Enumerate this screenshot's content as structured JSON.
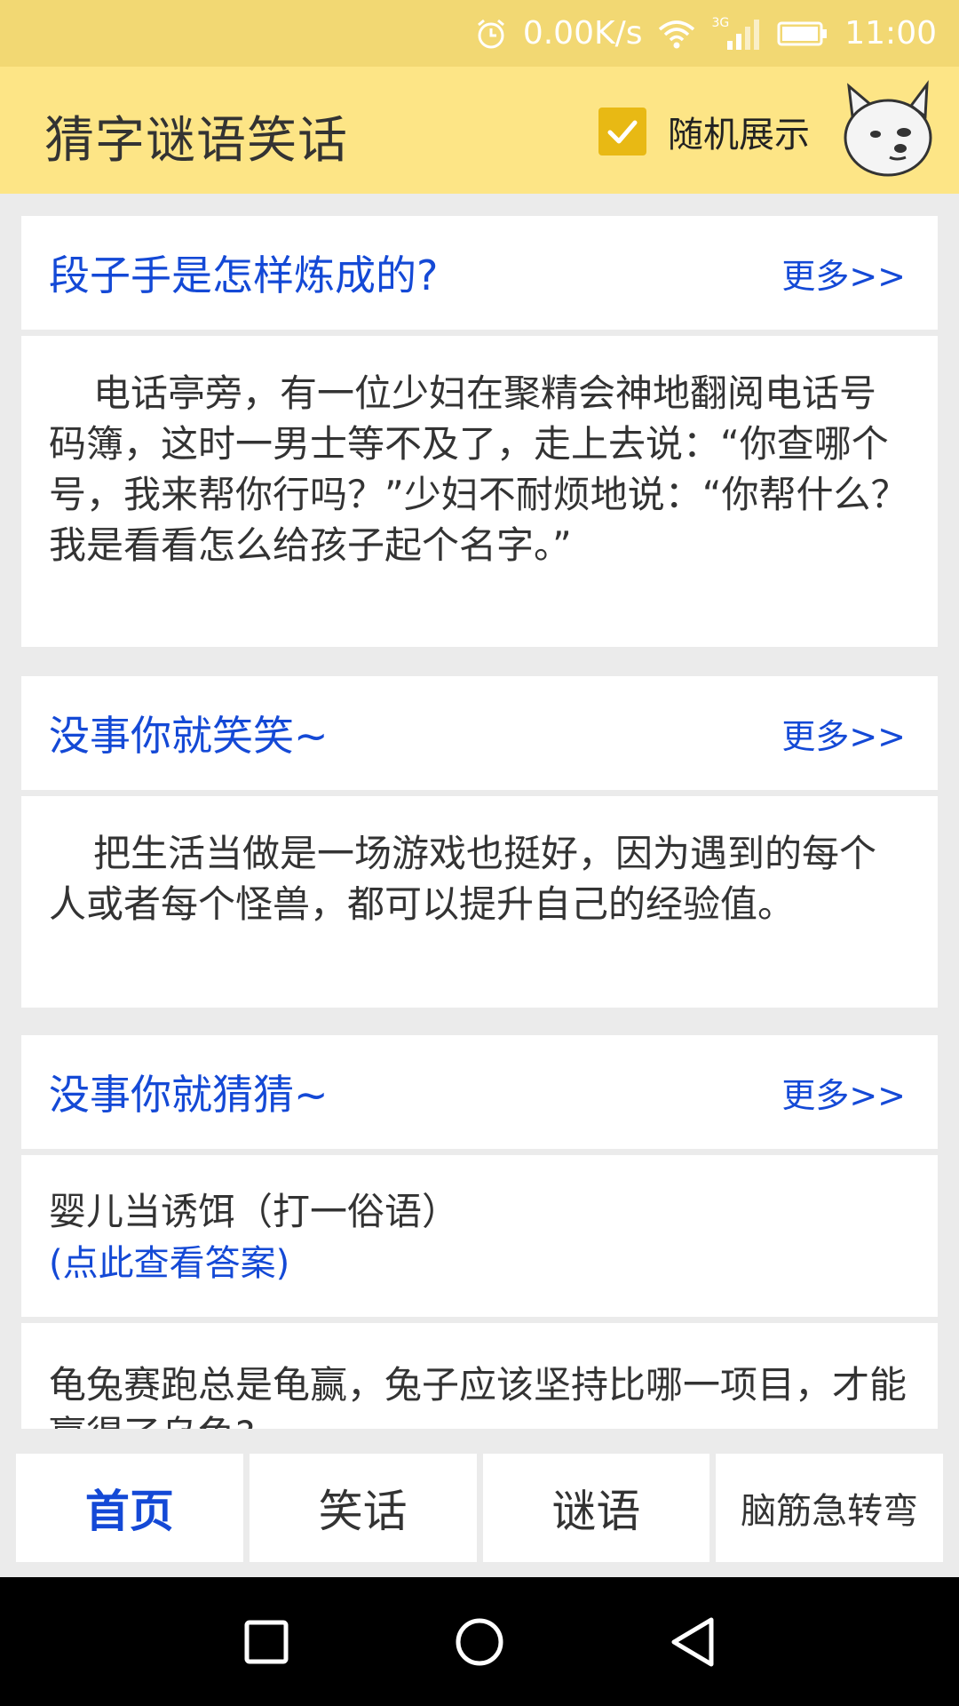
{
  "status_bar": {
    "speed": "0.00K/s",
    "network": "3G",
    "time": "11:00"
  },
  "app_bar": {
    "title": "猜字谜语笑话",
    "random_label": "随机展示",
    "random_checked": true
  },
  "sections": [
    {
      "title": "段子手是怎样炼成的?",
      "more": "更多>>",
      "body": "电话亭旁，有一位少妇在聚精会神地翻阅电话号码簿，这时一男士等不及了，走上去说：“你查哪个号，我来帮你行吗？”少妇不耐烦地说：“你帮什么？我是看看怎么给孩子起个名字。”"
    },
    {
      "title": "没事你就笑笑~",
      "more": "更多>>",
      "body": "把生活当做是一场游戏也挺好，因为遇到的每个人或者每个怪兽，都可以提升自己的经验值。"
    },
    {
      "title": "没事你就猜猜~",
      "more": "更多>>",
      "riddles": [
        {
          "question": "婴儿当诱饵（打一俗语）",
          "answer_link": "(点此查看答案)"
        },
        {
          "question": "龟兔赛跑总是龟赢，兔子应该坚持比哪一项目，才能赢得了乌龟?"
        }
      ]
    }
  ],
  "tabs": [
    "首页",
    "笑话",
    "谜语",
    "脑筋急转弯"
  ],
  "active_tab": 0,
  "colors": {
    "status_bar": "#f2d873",
    "app_bar": "#fde586",
    "accent_blue": "#1449d6",
    "checkbox": "#e8b914"
  }
}
